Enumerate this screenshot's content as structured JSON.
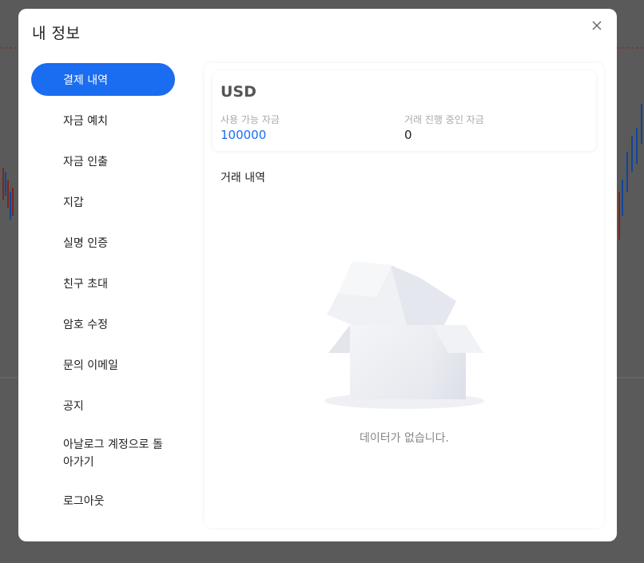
{
  "modal": {
    "title": "내 정보"
  },
  "sidebar": {
    "items": [
      {
        "label": "결제 내역",
        "active": true
      },
      {
        "label": "자금 예치"
      },
      {
        "label": "자금 인출"
      },
      {
        "label": "지갑"
      },
      {
        "label": "실명 인증"
      },
      {
        "label": "친구 초대"
      },
      {
        "label": "암호 수정"
      },
      {
        "label": "문의 이메일"
      },
      {
        "label": "공지"
      },
      {
        "label": "아날로그 계정으로 돌아가기"
      },
      {
        "label": "로그아웃"
      }
    ]
  },
  "balance": {
    "currency": "USD",
    "available_label": "사용 가능 자금",
    "available_value": "100000",
    "in_progress_label": "거래 진행 중인 자금",
    "in_progress_value": "0"
  },
  "history": {
    "title": "거래 내역",
    "empty_text": "데이터가 없습니다."
  },
  "colors": {
    "accent": "#1a6cf0",
    "overlay": "#8a8a8a"
  }
}
